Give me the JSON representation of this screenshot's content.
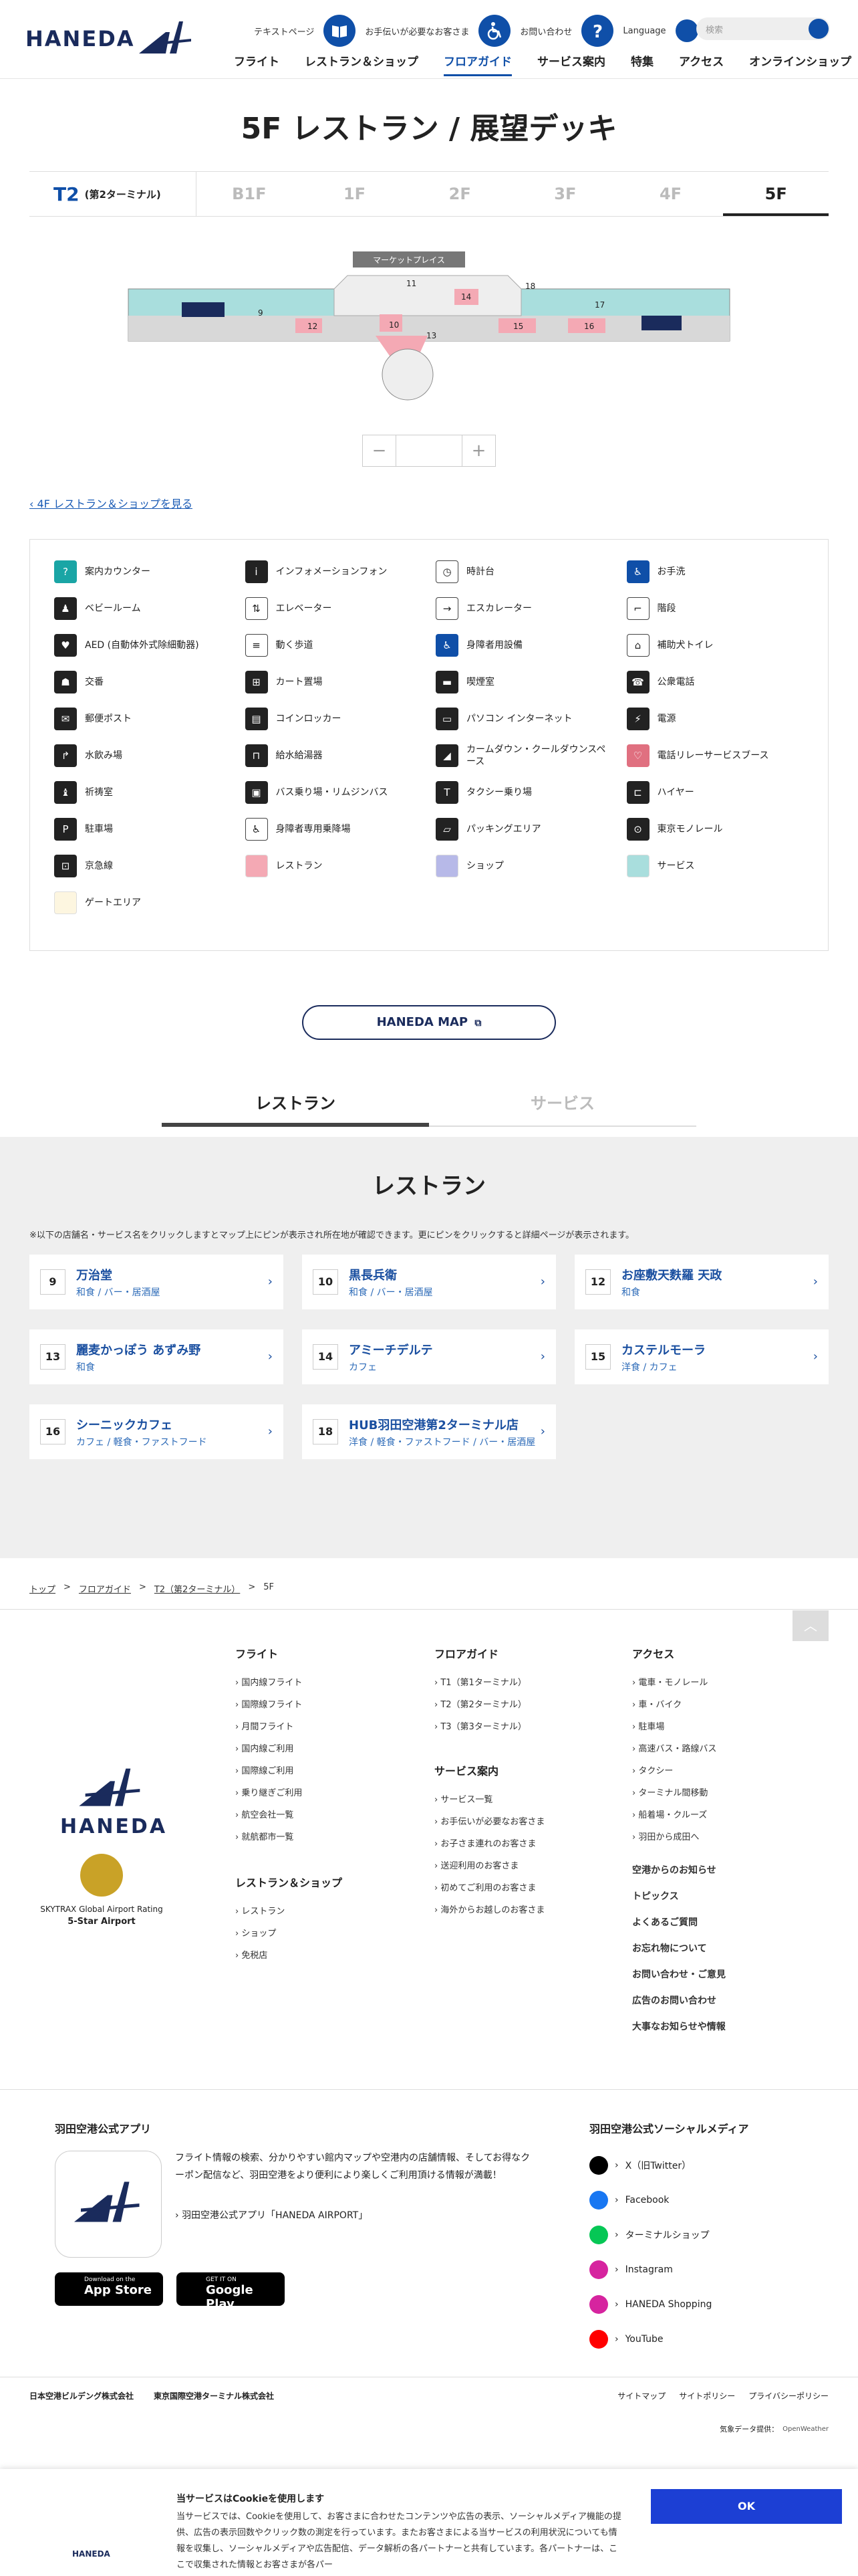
{
  "header": {
    "logo": "HANEDA",
    "utils": [
      "テキストページ",
      "お手伝いが必要なお客さま",
      "お問い合わせ",
      "Language"
    ],
    "search_placeholder": "検索",
    "nav": [
      "フライト",
      "レストラン＆ショップ",
      "フロアガイド",
      "サービス案内",
      "特集",
      "アクセス",
      "オンラインショップ"
    ],
    "active_nav": "フロアガイド"
  },
  "page_title": "5F レストラン / 展望デッキ",
  "terminal": {
    "code": "T2",
    "name": "(第2ターミナル)"
  },
  "floors": [
    "B1F",
    "1F",
    "2F",
    "3F",
    "4F",
    "5F"
  ],
  "current_floor": "5F",
  "map": {
    "marketplace_label": "マーケットプレイス",
    "numbers": [
      "9",
      "10",
      "11",
      "12",
      "13",
      "14",
      "15",
      "16",
      "17",
      "18"
    ],
    "zoom": {
      "minus": "−",
      "plus": "+"
    }
  },
  "back_link": "4F レストラン＆ショップを見る",
  "legend": [
    {
      "icon": "info-counter-icon",
      "label": "案内カウンター",
      "glyph": "?",
      "color": "#1aa5a5"
    },
    {
      "icon": "info-phone-icon",
      "label": "インフォメーションフォン",
      "glyph": "i",
      "color": "#222222"
    },
    {
      "icon": "clock-icon",
      "label": "時計台",
      "glyph": "◷",
      "color": "#ffffff"
    },
    {
      "icon": "restroom-icon",
      "label": "お手洗",
      "glyph": "♿",
      "color": "#0f4fa8"
    },
    {
      "icon": "baby-room-icon",
      "label": "ベビールーム",
      "glyph": "♟",
      "color": "#222222"
    },
    {
      "icon": "elevator-icon",
      "label": "エレベーター",
      "glyph": "⇅",
      "color": "#ffffff"
    },
    {
      "icon": "escalator-icon",
      "label": "エスカレーター",
      "glyph": "→",
      "color": "#ffffff"
    },
    {
      "icon": "stairs-icon",
      "label": "階段",
      "glyph": "⌐",
      "color": "#ffffff"
    },
    {
      "icon": "aed-icon",
      "label": "AED (自動体外式除細動器)",
      "glyph": "♥",
      "color": "#222222"
    },
    {
      "icon": "moving-walkway-icon",
      "label": "動く歩道",
      "glyph": "≡",
      "color": "#ffffff"
    },
    {
      "icon": "accessible-facility-icon",
      "label": "身障者用設備",
      "glyph": "♿",
      "color": "#0f4fa8"
    },
    {
      "icon": "assistance-dog-toilet-icon",
      "label": "補助犬トイレ",
      "glyph": "⌂",
      "color": "#ffffff"
    },
    {
      "icon": "police-icon",
      "label": "交番",
      "glyph": "☗",
      "color": "#222222"
    },
    {
      "icon": "cart-icon",
      "label": "カート置場",
      "glyph": "⊞",
      "color": "#222222"
    },
    {
      "icon": "smoking-room-icon",
      "label": "喫煙室",
      "glyph": "▬",
      "color": "#222222"
    },
    {
      "icon": "payphone-icon",
      "label": "公衆電話",
      "glyph": "☎",
      "color": "#222222"
    },
    {
      "icon": "postbox-icon",
      "label": "郵便ポスト",
      "glyph": "✉",
      "color": "#222222"
    },
    {
      "icon": "coin-locker-icon",
      "label": "コインロッカー",
      "glyph": "▤",
      "color": "#222222"
    },
    {
      "icon": "pc-internet-icon",
      "label": "パソコン インターネット",
      "glyph": "▭",
      "color": "#222222"
    },
    {
      "icon": "power-outlet-icon",
      "label": "電源",
      "glyph": "⚡",
      "color": "#222222"
    },
    {
      "icon": "water-fountain-icon",
      "label": "水飲み場",
      "glyph": "↱",
      "color": "#222222"
    },
    {
      "icon": "water-supply-icon",
      "label": "給水給湯器",
      "glyph": "⊓",
      "color": "#222222"
    },
    {
      "icon": "calm-down-space-icon",
      "label": "カームダウン・クールダウンスペース",
      "glyph": "◢",
      "color": "#222222"
    },
    {
      "icon": "telephone-relay-icon",
      "label": "電話リレーサービスブース",
      "glyph": "♡",
      "color": "#e07080"
    },
    {
      "icon": "prayer-room-icon",
      "label": "祈祷室",
      "glyph": "♝",
      "color": "#222222"
    },
    {
      "icon": "bus-icon",
      "label": "バス乗り場・リムジンバス",
      "glyph": "▣",
      "color": "#222222"
    },
    {
      "icon": "taxi-icon",
      "label": "タクシー乗り場",
      "glyph": "T",
      "color": "#222222"
    },
    {
      "icon": "hire-car-icon",
      "label": "ハイヤー",
      "glyph": "⊏",
      "color": "#222222"
    },
    {
      "icon": "parking-icon",
      "label": "駐車場",
      "glyph": "P",
      "color": "#222222"
    },
    {
      "icon": "accessible-parking-icon",
      "label": "身障者専用乗降場",
      "glyph": "♿",
      "color": "#ffffff"
    },
    {
      "icon": "packing-area-icon",
      "label": "パッキングエリア",
      "glyph": "▱",
      "color": "#222222"
    },
    {
      "icon": "monorail-icon",
      "label": "東京モノレール",
      "glyph": "⊙",
      "color": "#222222"
    },
    {
      "icon": "keikyu-icon",
      "label": "京急線",
      "glyph": "⊡",
      "color": "#222222"
    },
    {
      "icon": "restaurant-swatch",
      "label": "レストラン",
      "glyph": "",
      "color": "#f4a9b4"
    },
    {
      "icon": "shop-swatch",
      "label": "ショップ",
      "glyph": "",
      "color": "#b7b9e8"
    },
    {
      "icon": "service-swatch",
      "label": "サービス",
      "glyph": "",
      "color": "#a9dedd"
    },
    {
      "icon": "gate-area-swatch",
      "label": "ゲートエリア",
      "glyph": "",
      "color": "#fdf6e0"
    }
  ],
  "haneda_map_button": "HANEDA MAP",
  "section_tabs": [
    "レストラン",
    "サービス"
  ],
  "restaurant_section": {
    "title": "レストラン",
    "note": "※以下の店舗名・サービス名をクリックしますとマップ上にピンが表示され所在地が確認できます。更にピンをクリックすると詳細ページが表示されます。",
    "cards": [
      {
        "num": "9",
        "name": "万治堂",
        "cat": "和食 / バー・居酒屋"
      },
      {
        "num": "10",
        "name": "黒長兵衛",
        "cat": "和食 / バー・居酒屋"
      },
      {
        "num": "12",
        "name": "お座敷天麩羅 天政",
        "cat": "和食"
      },
      {
        "num": "13",
        "name": "麗麦かっぽう あずみ野",
        "cat": "和食"
      },
      {
        "num": "14",
        "name": "アミーチデルテ",
        "cat": "カフェ"
      },
      {
        "num": "15",
        "name": "カステルモーラ",
        "cat": "洋食 / カフェ"
      },
      {
        "num": "16",
        "name": "シーニックカフェ",
        "cat": "カフェ / 軽食・ファストフード"
      },
      {
        "num": "18",
        "name": "HUB羽田空港第2ターミナル店",
        "cat": "洋食 / 軽食・ファストフード / バー・居酒屋"
      }
    ]
  },
  "breadcrumb": [
    "トップ",
    "フロアガイド",
    "T2（第2ターミナル）",
    "5F"
  ],
  "footer": {
    "rating_line1": "SKYTRAX Global Airport Rating",
    "rating_line2": "5-Star Airport",
    "cols": [
      {
        "title": "フライト",
        "items": [
          "国内線フライト",
          "国際線フライト",
          "月間フライト",
          "国内線ご利用",
          "国際線ご利用",
          "乗り継ぎご利用",
          "航空会社一覧",
          "就航都市一覧"
        ]
      },
      {
        "title": "フロアガイド",
        "items": [
          "T1（第1ターミナル）",
          "T2（第2ターミナル）",
          "T3（第3ターミナル）"
        ]
      },
      {
        "title": "アクセス",
        "items": [
          "電車・モノレール",
          "車・バイク",
          "駐車場",
          "高速バス・路線バス",
          "タクシー",
          "ターミナル間移動",
          "船着場・クルーズ",
          "羽田から成田へ"
        ]
      }
    ],
    "services": {
      "title": "サービス案内",
      "items": [
        "サービス一覧",
        "お手伝いが必要なお客さま",
        "お子さま連れのお客さま",
        "送迎利用のお客さま",
        "初めてご利用のお客さま",
        "海外からお越しのお客さま"
      ]
    },
    "shops": {
      "title": "レストラン＆ショップ",
      "items": [
        "レストラン",
        "ショップ",
        "免税店"
      ]
    },
    "links_bold": [
      "空港からのお知らせ",
      "トピックス",
      "よくあるご質問",
      "お忘れ物について",
      "お問い合わせ・ご意見",
      "広告のお問い合わせ",
      "大事なお知らせや情報"
    ],
    "app_title": "羽田空港公式アプリ",
    "app_desc": "フライト情報の検索、分かりやすい館内マップや空港内の店舗情報、そしてお得なクーポン配信など、羽田空港をより便利により楽しくご利用頂ける情報が満載！",
    "app_link": "羽田空港公式アプリ「HANEDA AIRPORT」",
    "app_store": "App Store",
    "app_store_sub": "Download on the",
    "google_play": "Google Play",
    "google_play_sub": "GET IT ON",
    "social_title": "羽田空港公式ソーシャルメディア",
    "social": [
      {
        "label": "X（旧Twitter）",
        "color": "#000000"
      },
      {
        "label": "Facebook",
        "color": "#1877f2"
      },
      {
        "label": "ターミナルショップ",
        "color": "#06c755"
      },
      {
        "label": "Instagram",
        "color": "#d6249f"
      },
      {
        "label": "HANEDA Shopping",
        "color": "#d6249f"
      },
      {
        "label": "YouTube",
        "color": "#ff0000"
      }
    ],
    "companies": [
      "日本空港ビルデング株式会社",
      "東京国際空港ターミナル株式会社"
    ],
    "bottom_links": [
      "サイトマップ",
      "サイトポリシー",
      "プライバシーポリシー"
    ],
    "weather": "気象データ提供：",
    "weather_brand": "OpenWeather"
  },
  "cookie": {
    "title": "当サービスはCookieを使用します",
    "text": "当サービスでは、Cookieを使用して、お客さまに合わせたコンテンツや広告の表示、ソーシャルメディア機能の提供、広告の表示回数やクリック数の測定を行っています。またお客さまによる当サービスの利用状況についても情報を収集し、ソーシャルメディアや広告配信、データ解析の各パートナーと共有しています。各パートナーは、ここで収集された情報とお客さまが各パー",
    "ok": "OK",
    "logo": "HANEDA"
  }
}
